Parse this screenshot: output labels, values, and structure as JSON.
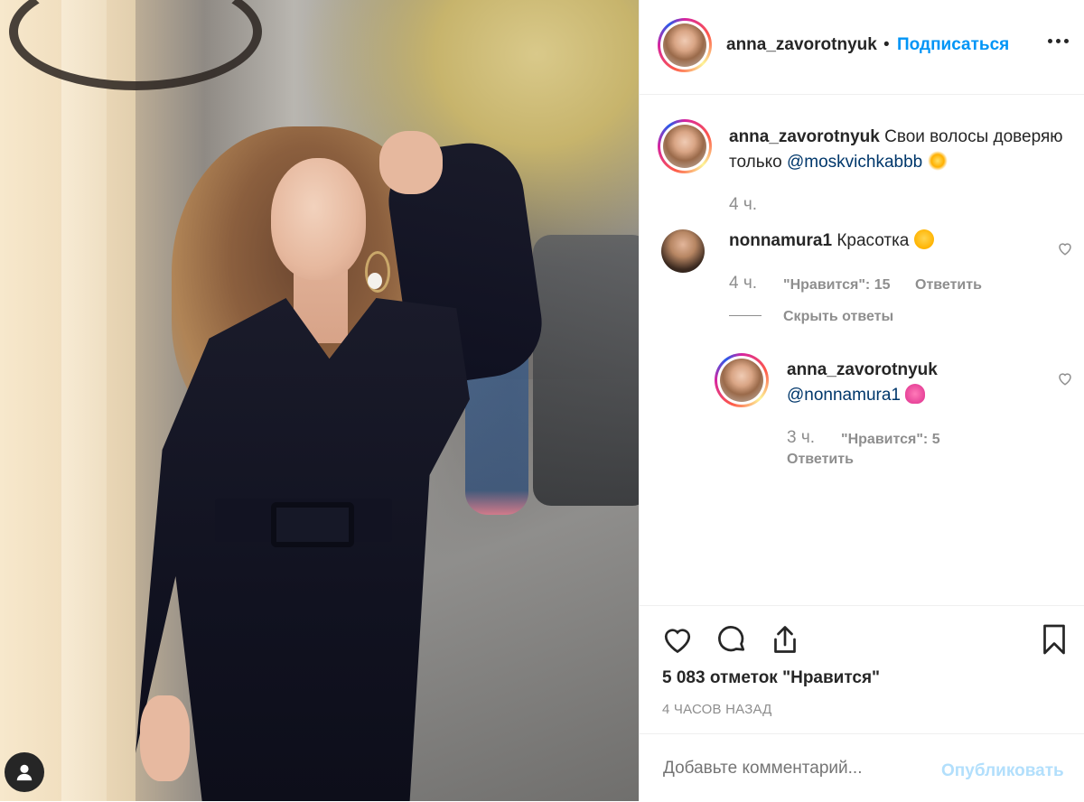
{
  "post": {
    "author": "anna_zavorotnyuk",
    "follow_label": "Подписаться",
    "separator": "•",
    "caption_text": "Свои волосы доверяю только",
    "caption_mention": "@moskvichkabbb",
    "caption_time": "4 ч."
  },
  "comments": [
    {
      "user": "nonnamura1",
      "text": "Красотка",
      "time": "4 ч.",
      "likes": "\"Нравится\": 15",
      "reply_label": "Ответить",
      "hide_replies": "Скрыть ответы",
      "replies": [
        {
          "user": "anna_zavorotnyuk",
          "mention": "@nonnamura1",
          "time": "3 ч.",
          "likes": "\"Нравится\": 5",
          "reply_label": "Ответить"
        }
      ]
    }
  ],
  "stats": {
    "likes": "5 083 отметок \"Нравится\"",
    "posted": "4 ЧАСОВ НАЗАД"
  },
  "composer": {
    "placeholder": "Добавьте комментарий...",
    "publish_label": "Опубликовать"
  },
  "colors": {
    "link": "#00376b",
    "accent": "#0095f6",
    "muted": "#8e8e8e"
  },
  "icons": [
    "more-icon",
    "heart-icon",
    "comment-icon",
    "share-icon",
    "bookmark-icon",
    "sparkle-emoji",
    "heart-eyes-emoji",
    "pink-heart-emoji",
    "profile-icon"
  ]
}
